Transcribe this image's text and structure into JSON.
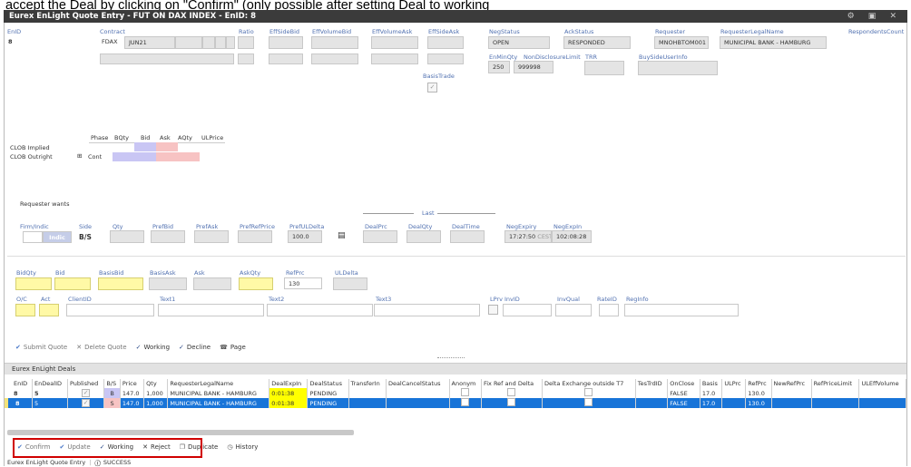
{
  "caption": "accept the Deal by clicking on \"Confirm\" (only possible after setting Deal to working",
  "window": {
    "title": "Eurex EnLight Quote Entry - FUT ON DAX INDEX - EnID: 8",
    "controls": "⚙ ▣ ✕"
  },
  "header_fields": {
    "enid_label": "EnID",
    "enid_value": "8",
    "contract_label": "Contract",
    "contract_product": "FDAX",
    "contract_expiry": "JUN21",
    "ratio_label": "Ratio",
    "effsidebid_label": "EffSideBid",
    "effvolumebid_label": "EffVolumeBid",
    "effvolumeask_label": "EffVolumeAsk",
    "effsideask_label": "EffSideAsk",
    "negstatus_label": "NegStatus",
    "negstatus_value": "OPEN",
    "ackstatus_label": "AckStatus",
    "ackstatus_value": "RESPONDED",
    "requester_label": "Requester",
    "requester_value": "MNOHBTOM001",
    "requesterlegal_label": "RequesterLegalName",
    "requesterlegal_value": "MUNICIPAL BANK - HAMBURG",
    "respcount_label": "RespondentsCount",
    "enminqty_label": "EnMinQty",
    "enminqty_value": "250",
    "nondisc_label": "NonDisclosureLimit",
    "nondisc_value": "999998",
    "trr_label": "TRR",
    "buyside_label": "BuySideUserInfo",
    "basistrade_label": "BasisTrade"
  },
  "clob": {
    "headers": [
      "Phase",
      "BQty",
      "Bid",
      "Ask",
      "AQty",
      "ULPrice"
    ],
    "row1": "CLOB Implied",
    "row2": "CLOB Outright",
    "cont": "Cont",
    "expand": "⊞"
  },
  "requester_wants": {
    "title": "Requester wants",
    "firm_label": "Firm/Indic",
    "firm_value": "Indic",
    "side_label": "Side",
    "side_value": "B/S",
    "qty_label": "Qty",
    "prefbid_label": "PrefBid",
    "prefask_label": "PrefAsk",
    "prefrefprice_label": "PrefRefPrice",
    "prefuldelta_label": "PrefULDelta",
    "prefuldelta_value": "100.0",
    "last_label": "Last",
    "dealprc_label": "DealPrc",
    "dealqty_label": "DealQty",
    "dealtime_label": "DealTime",
    "negexpiry_label": "NegExpiry",
    "negexpiry_value": "17:27:50",
    "negexpiry_tz": "CEST",
    "negexpin_label": "NegExpIn",
    "negexpin_value": "102:08:28"
  },
  "quote_fields": {
    "bidqty": "BidQty",
    "bid": "Bid",
    "basisbid": "BasisBid",
    "basisask": "BasisAsk",
    "ask": "Ask",
    "askqty": "AskQty",
    "refprc": "RefPrc",
    "refprc_value": "130",
    "uldelta": "ULDelta",
    "oc": "O/C",
    "act": "Act",
    "clientid": "ClientID",
    "text1": "Text1",
    "text2": "Text2",
    "text3": "Text3",
    "lprv": "LPrv",
    "invid": "InvID",
    "invqual": "InvQual",
    "rateid": "RateID",
    "reginfo": "RegInfo"
  },
  "quote_toolbar": {
    "submit": "Submit Quote",
    "delete": "Delete Quote",
    "working": "Working",
    "decline": "Decline",
    "page": "Page"
  },
  "deals": {
    "section_title": "Eurex EnLight Deals",
    "columns": [
      "EnID",
      "EnDealID",
      "Published",
      "B/S",
      "Price",
      "Qty",
      "RequesterLegalName",
      "DealExpIn",
      "DealStatus",
      "TransferIn",
      "DealCancelStatus",
      "Anonym",
      "Fix Ref and Delta",
      "Delta Exchange outside T7",
      "TesTrdID",
      "OnClose",
      "Basis",
      "ULPrc",
      "RefPrc",
      "NewRefPrc",
      "RefPriceLimit",
      "ULEffVolume"
    ],
    "rows": [
      {
        "enid": "8",
        "dealid": "5",
        "bs": "B",
        "price": "147.0",
        "qty": "1,000",
        "name": "MUNICIPAL BANK - HAMBURG",
        "expin": "0:01:38",
        "status": "PENDING",
        "onclose": "FALSE",
        "basis": "17.0",
        "refprc": "130.0"
      },
      {
        "enid": "8",
        "dealid": "5",
        "bs": "S",
        "price": "147.0",
        "qty": "1,000",
        "name": "MUNICIPAL BANK - HAMBURG",
        "expin": "0:01:38",
        "status": "PENDING",
        "onclose": "FALSE",
        "basis": "17.0",
        "refprc": "130.0"
      }
    ]
  },
  "deal_toolbar": {
    "confirm": "Confirm",
    "update": "Update",
    "working": "Working",
    "reject": "Reject",
    "duplicate": "Duplicate",
    "history": "History"
  },
  "status_bar": {
    "app": "Eurex EnLight Quote Entry",
    "status": "SUCCESS"
  },
  "colors": {
    "titlebar": "#3b3b3b",
    "label_blue": "#5070b0",
    "highlight_yellow": "#ffff00",
    "selection_blue": "#1874d8",
    "annotation_red": "#d00000"
  }
}
